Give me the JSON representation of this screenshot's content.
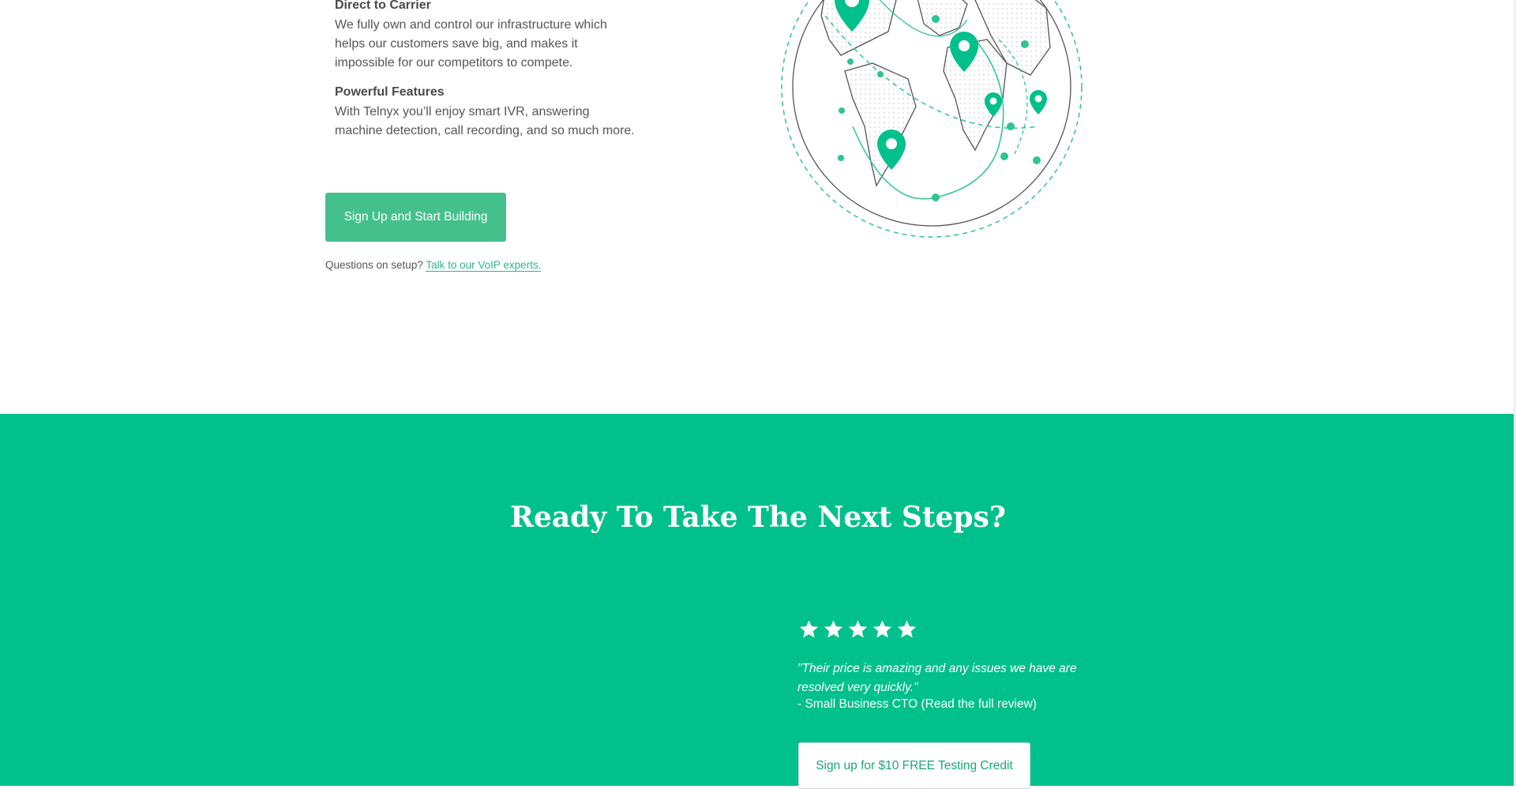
{
  "features": [
    {
      "title": "Direct to Carrier",
      "text": "We fully own and control our infrastructure which helps our customers save big, and makes it impossible for our competitors to compete."
    },
    {
      "title": "Powerful Features",
      "text": "With Telnyx you’ll enjoy smart IVR, answering machine detection, call recording, and so much more."
    }
  ],
  "cta": {
    "label": "Sign Up and Start Building"
  },
  "setup": {
    "question": "Questions on setup?",
    "link": "Talk to our VoIP experts."
  },
  "globe": {
    "icon": "globe-map-illustration"
  },
  "next_steps": {
    "headline": "Ready To Take The Next Steps?",
    "rating": 5,
    "quote": "\"Their price is amazing and any issues we have are resolved very quickly.\"",
    "author": "- Small Business CTO (Read the full review)",
    "button": "Sign up for $10 FREE Testing Credit"
  },
  "colors": {
    "brand_green": "#00c08b",
    "button_green": "#44c08c",
    "link_green": "#2db884"
  }
}
